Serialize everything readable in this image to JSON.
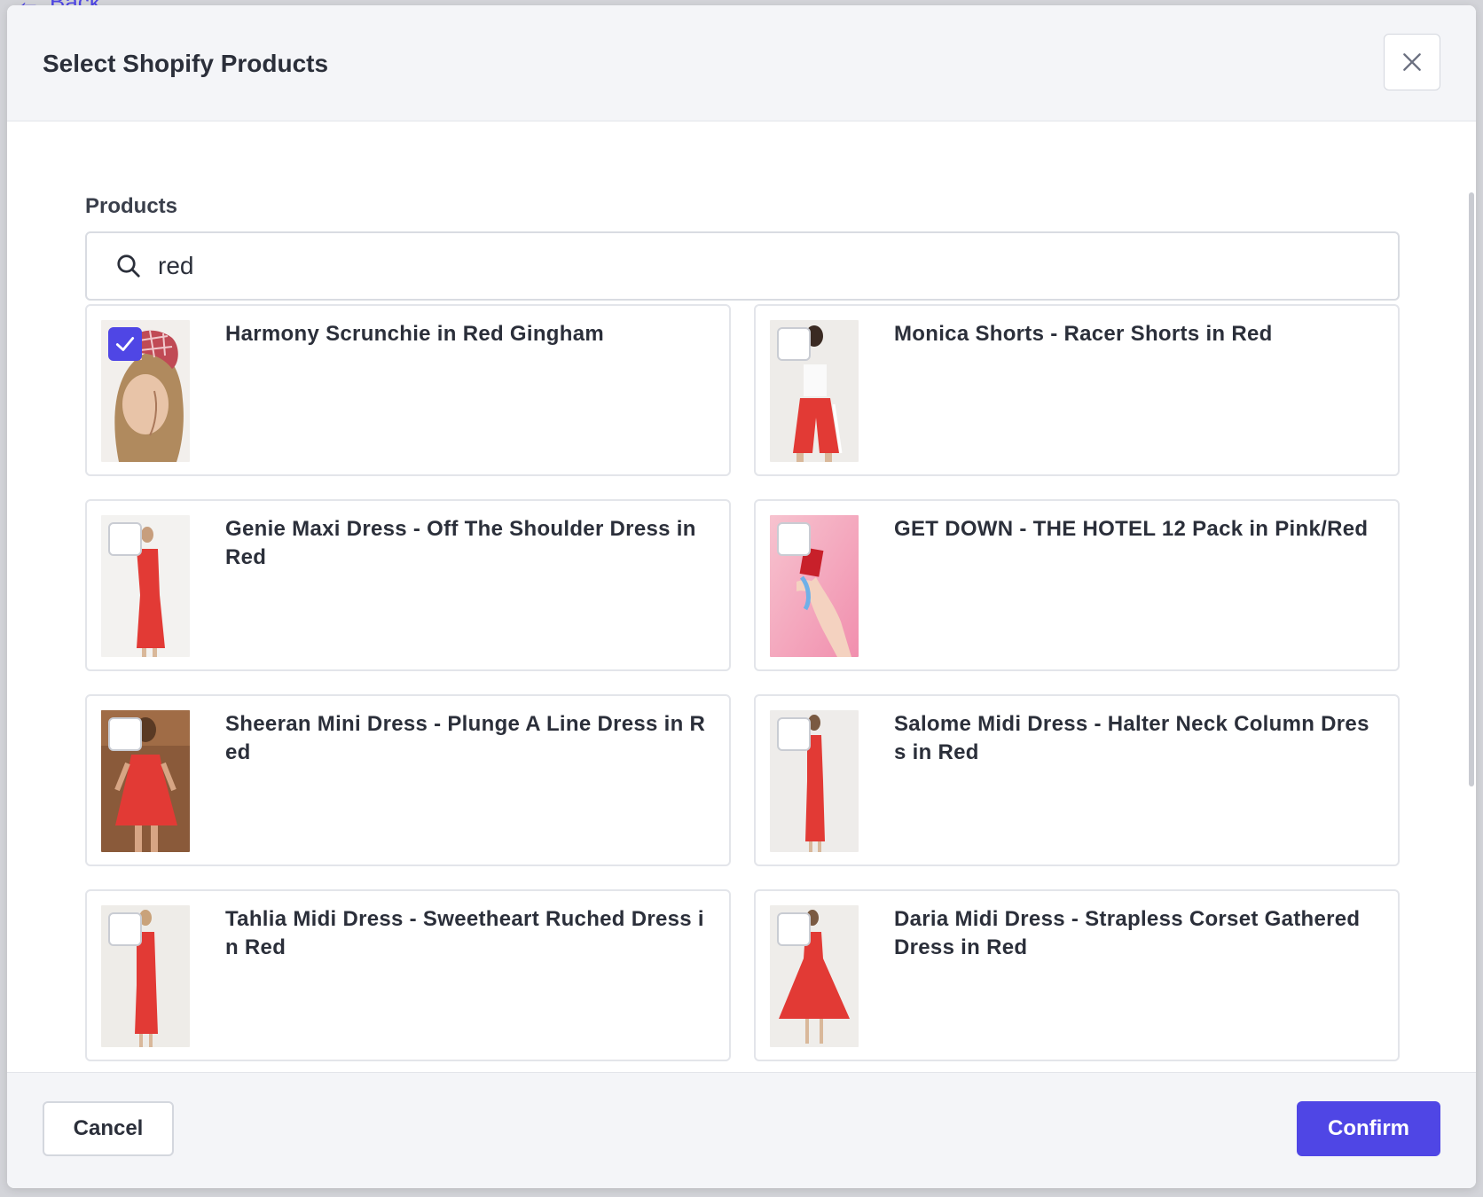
{
  "background": {
    "back_label": "Back"
  },
  "modal": {
    "title": "Select Shopify Products",
    "close_icon": "close-icon"
  },
  "search": {
    "label": "Products",
    "value": "red",
    "placeholder": "",
    "icon": "search-icon"
  },
  "products": [
    {
      "title": "Harmony Scrunchie in Red Gingham",
      "checked": true
    },
    {
      "title": "Monica Shorts - Racer Shorts in Red",
      "checked": false
    },
    {
      "title": "Genie Maxi Dress - Off The Shoulder Dress in Red",
      "checked": false
    },
    {
      "title": "GET DOWN - THE HOTEL 12 Pack in Pink/Red",
      "checked": false
    },
    {
      "title": "Sheeran Mini Dress - Plunge A Line Dress in Red",
      "checked": false
    },
    {
      "title": "Salome Midi Dress - Halter Neck Column Dress in Red",
      "checked": false
    },
    {
      "title": "Tahlia Midi Dress - Sweetheart Ruched Dress in Red",
      "checked": false
    },
    {
      "title": "Daria Midi Dress - Strapless Corset Gathered Dress in Red",
      "checked": false
    }
  ],
  "footer": {
    "cancel_label": "Cancel",
    "confirm_label": "Confirm"
  },
  "colors": {
    "accent": "#4f46e5",
    "product_red": "#e23a35"
  }
}
